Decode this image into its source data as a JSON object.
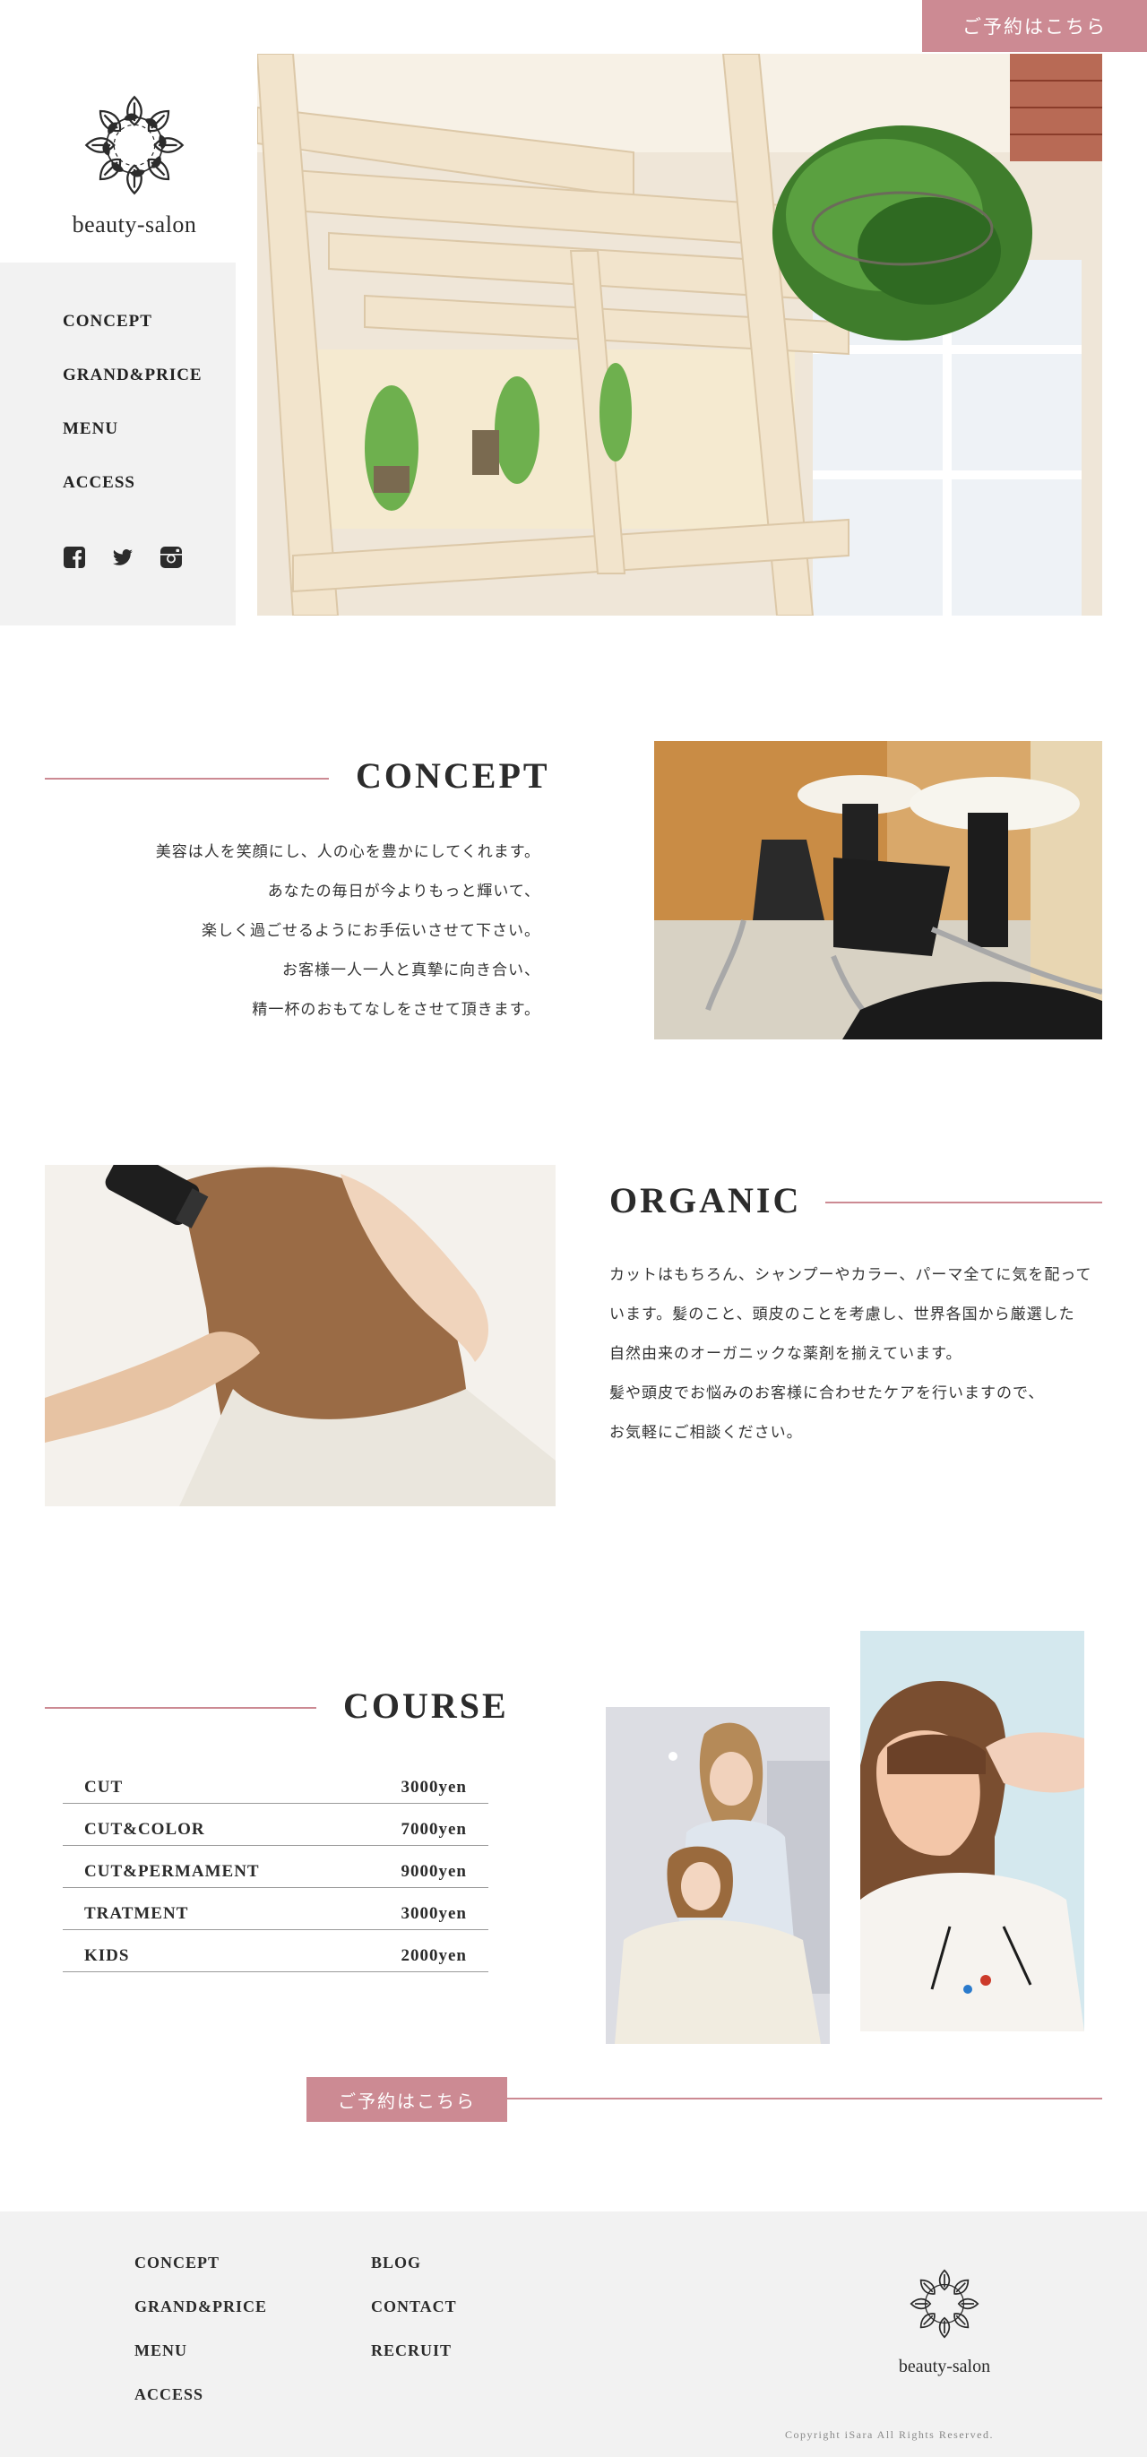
{
  "header": {
    "reserve_label": "ご予約はこちら"
  },
  "brand": {
    "name": "beauty-salon"
  },
  "nav": {
    "items": [
      {
        "label": "CONCEPT"
      },
      {
        "label": "GRAND&PRICE"
      },
      {
        "label": "MENU"
      },
      {
        "label": "ACCESS"
      }
    ],
    "social": [
      "facebook-icon",
      "twitter-icon",
      "instagram-icon"
    ]
  },
  "concept": {
    "title": "CONCEPT",
    "lines": [
      "美容は人を笑顔にし、人の心を豊かにしてくれます。",
      "あなたの毎日が今よりもっと輝いて、",
      "楽しく過ごせるようにお手伝いさせて下さい。",
      "お客様一人一人と真摯に向き合い、",
      "精一杯のおもてなしをさせて頂きます。"
    ]
  },
  "organic": {
    "title": "ORGANIC",
    "lines": [
      "カットはもちろん、シャンプーやカラー、パーマ全てに気を配って",
      "います。髪のこと、頭皮のことを考慮し、世界各国から厳選した",
      "自然由来のオーガニックな薬剤を揃えています。",
      "髪や頭皮でお悩みのお客様に合わせたケアを行いますので、",
      "お気軽にご相談ください。"
    ]
  },
  "course": {
    "title": "COURSE",
    "rows": [
      {
        "name": "CUT",
        "price": "3000yen"
      },
      {
        "name": "CUT&COLOR",
        "price": "7000yen"
      },
      {
        "name": "CUT&PERMAMENT",
        "price": "9000yen"
      },
      {
        "name": "TRATMENT",
        "price": "3000yen"
      },
      {
        "name": "KIDS",
        "price": "2000yen"
      }
    ],
    "reserve_label": "ご予約はこちら"
  },
  "footer": {
    "col1": [
      {
        "label": "CONCEPT"
      },
      {
        "label": "GRAND&PRICE"
      },
      {
        "label": "MENU"
      },
      {
        "label": "ACCESS"
      }
    ],
    "col2": [
      {
        "label": "BLOG"
      },
      {
        "label": "CONTACT"
      },
      {
        "label": "RECRUIT"
      }
    ],
    "brand": "beauty-salon",
    "copyright": "Copyright  iSara All Rights Reserved."
  },
  "colors": {
    "accent": "#cc8a93",
    "sidebar_bg": "#f2f2f2",
    "footer_bg": "#f2f2f2"
  }
}
